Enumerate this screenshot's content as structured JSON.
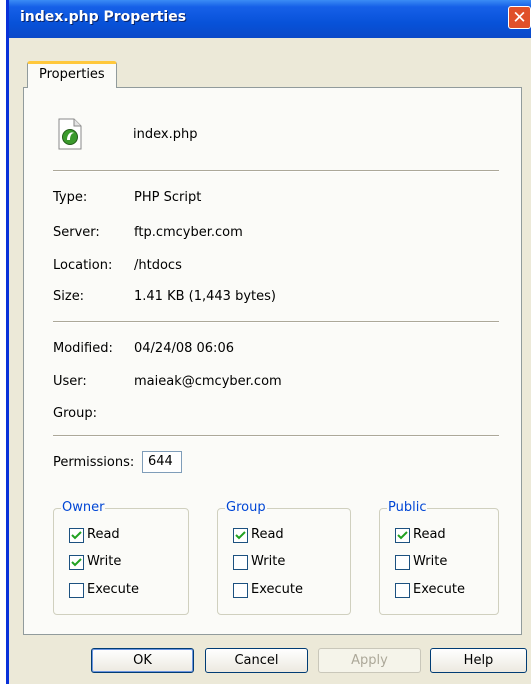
{
  "window": {
    "title": "index.php Properties",
    "close_glyph": "✕"
  },
  "tabs": [
    {
      "label": "Properties"
    }
  ],
  "file": {
    "name": "index.php",
    "icon": "php-file-icon"
  },
  "info": {
    "type_label": "Type:",
    "type_value": "PHP Script",
    "server_label": "Server:",
    "server_value": "ftp.cmcyber.com",
    "location_label": "Location:",
    "location_value": "/htdocs",
    "size_label": "Size:",
    "size_value": "1.41 KB (1,443 bytes)",
    "modified_label": "Modified:",
    "modified_value": "04/24/08 06:06",
    "user_label": "User:",
    "user_value": "maieak@cmcyber.com",
    "group_label": "Group:",
    "group_value": ""
  },
  "permissions": {
    "label": "Permissions:",
    "value": "644",
    "groups": [
      {
        "title": "Owner",
        "read": true,
        "write": true,
        "execute": false
      },
      {
        "title": "Group",
        "read": true,
        "write": false,
        "execute": false
      },
      {
        "title": "Public",
        "read": true,
        "write": false,
        "execute": false
      }
    ],
    "read_label": "Read",
    "write_label": "Write",
    "execute_label": "Execute"
  },
  "buttons": {
    "ok": "OK",
    "cancel": "Cancel",
    "apply": "Apply",
    "help": "Help"
  },
  "colors": {
    "titlebar": "#0852d9",
    "close": "#e0502a",
    "group_title": "#0046d5",
    "tab_highlight": "#ffc83c"
  }
}
